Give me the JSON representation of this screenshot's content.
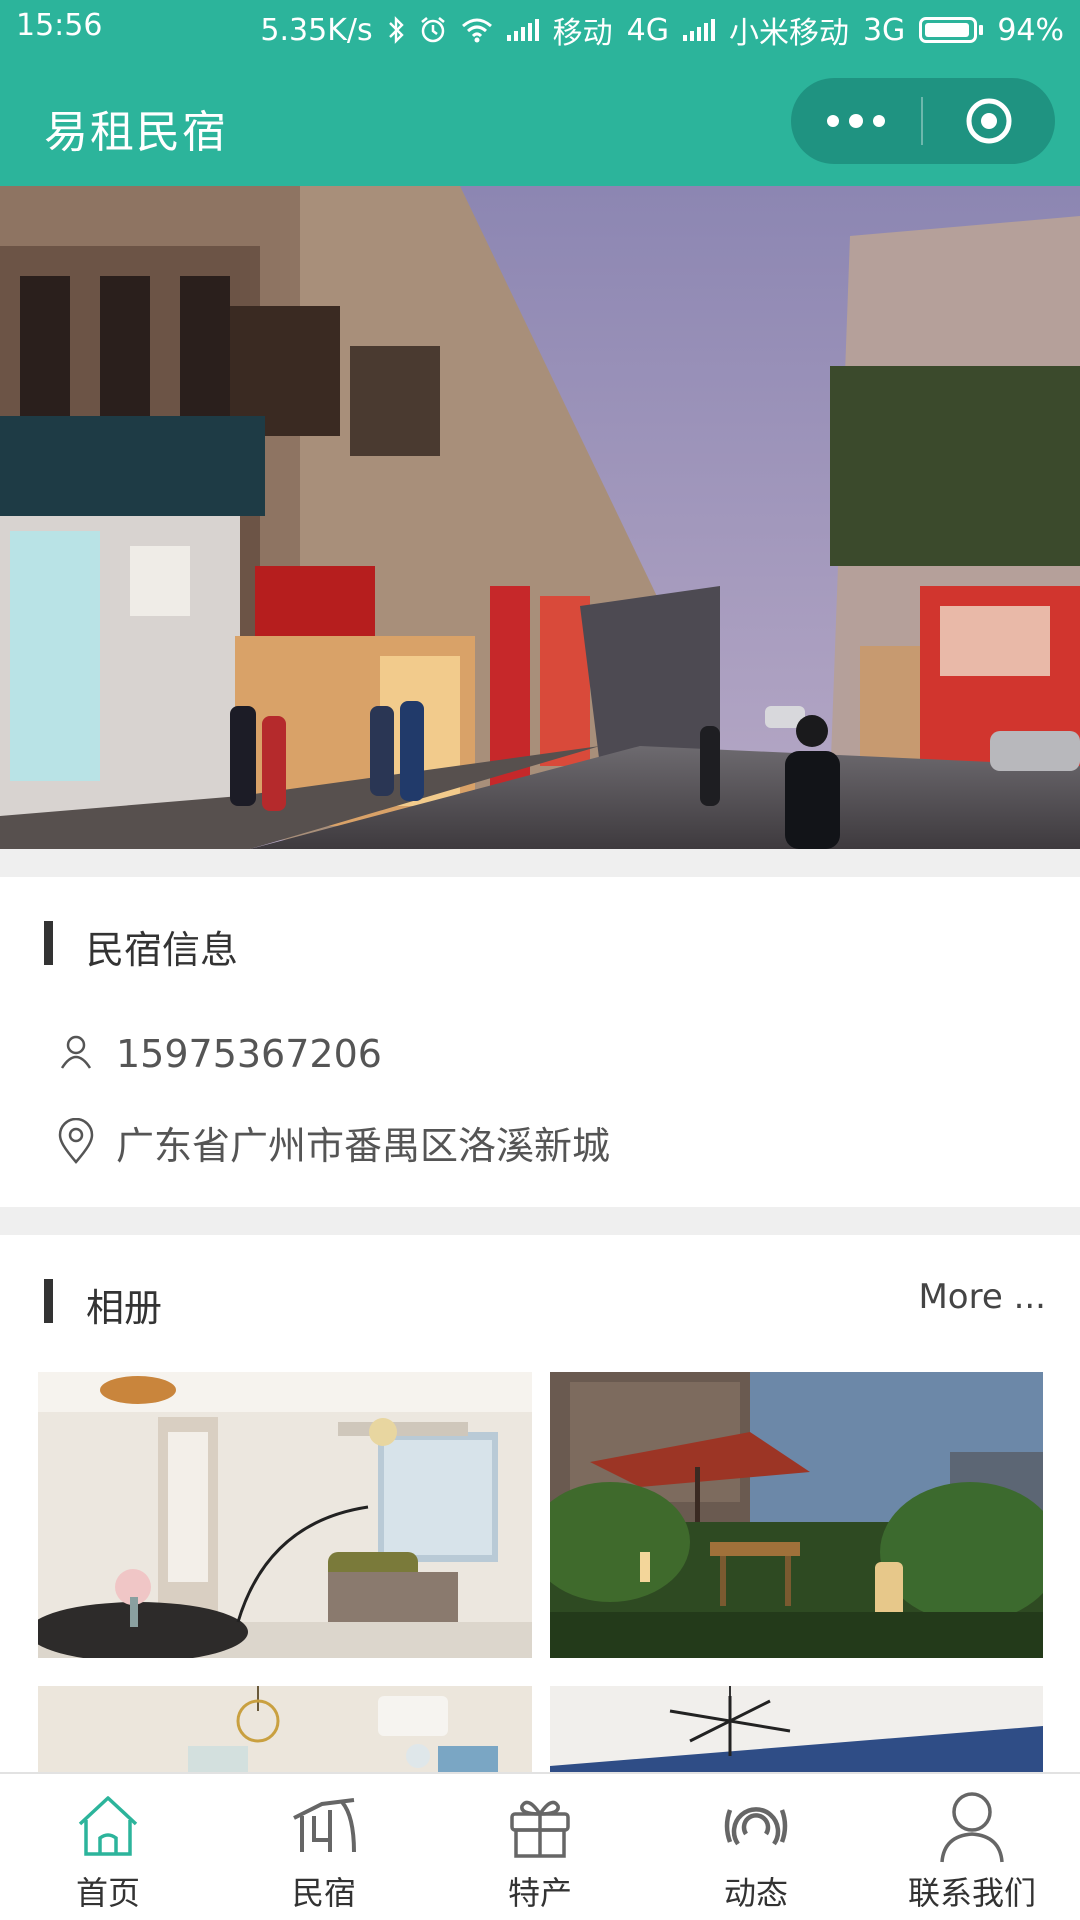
{
  "status_bar": {
    "time": "15:56",
    "net_speed": "5.35K/s",
    "carrier1": "移动",
    "net1": "4G",
    "carrier2": "小米移动",
    "net2": "3G",
    "battery": "94%",
    "battery_level": 0.94,
    "icons": [
      "bluetooth-icon",
      "alarm-icon",
      "wifi-icon",
      "signal-icon",
      "battery-icon"
    ]
  },
  "header": {
    "title": "易租民宿",
    "more_icon": "more-dots-icon",
    "close_icon": "target-circle-icon",
    "bg_color": "#2cb49b"
  },
  "banner": {
    "slide_count": 3,
    "active_index": 0
  },
  "info": {
    "section_title": "民宿信息",
    "phone": "15975367206",
    "address": "广东省广州市番禺区洛溪新城"
  },
  "album": {
    "section_title": "相册",
    "more_label": "More ..."
  },
  "tabbar": {
    "tabs": [
      {
        "label": "首页",
        "icon": "home-icon",
        "active": true
      },
      {
        "label": "民宿",
        "icon": "house-icon",
        "active": false
      },
      {
        "label": "特产",
        "icon": "gift-icon",
        "active": false
      },
      {
        "label": "动态",
        "icon": "broadcast-icon",
        "active": false
      },
      {
        "label": "联系我们",
        "icon": "user-icon",
        "active": false
      }
    ],
    "active_color": "#2cb49b"
  }
}
